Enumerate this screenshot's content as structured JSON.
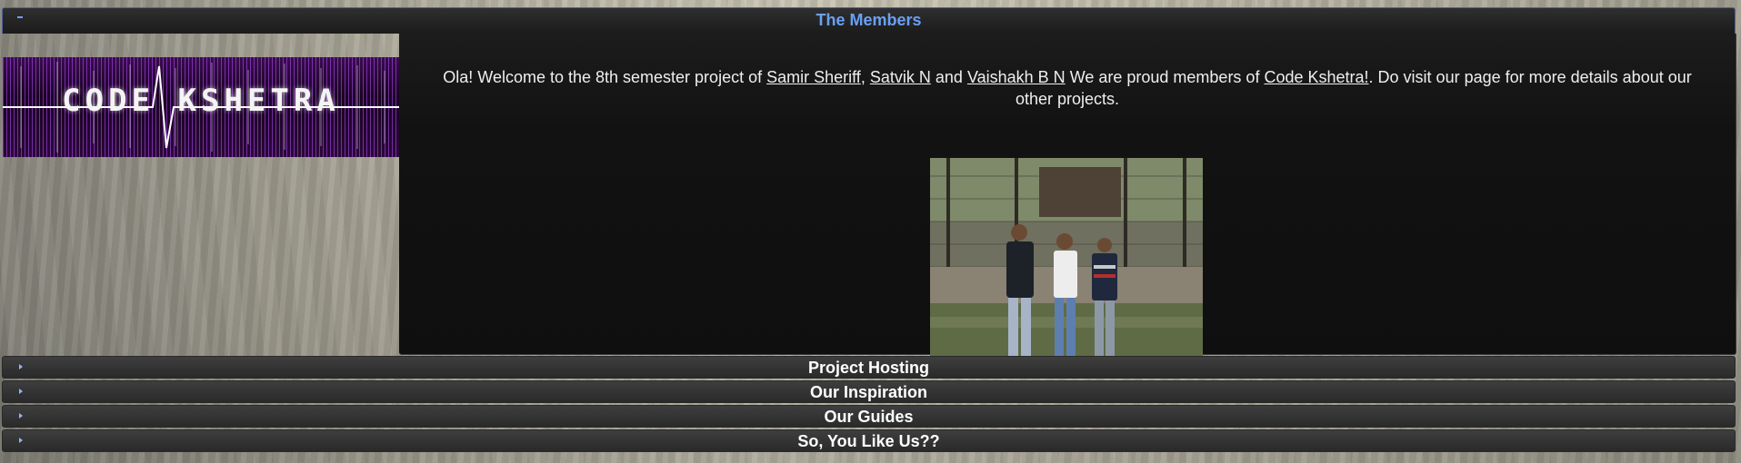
{
  "accordion": {
    "active": {
      "title": "The Members",
      "logo_text": "CODE KSHETRA",
      "intro": {
        "prefix": "Ola! Welcome to the 8th semester project of",
        "member1": "Samir Sheriff",
        "comma": ",",
        "member2": "Satvik N",
        "and": "and",
        "member3": "Vaishakh B N",
        "middle": "We are proud members of",
        "club": "Code Kshetra!",
        "suffix": ". Do visit our page for more details about our other projects."
      },
      "photo_caption": ""
    },
    "sections": [
      {
        "title": "Project Hosting"
      },
      {
        "title": "Our Inspiration"
      },
      {
        "title": "Our Guides"
      },
      {
        "title": "So, You Like Us??"
      }
    ]
  },
  "colors": {
    "active_title": "#6aa0f5",
    "panel_bg": "#111111",
    "header_bg": "#333333"
  }
}
